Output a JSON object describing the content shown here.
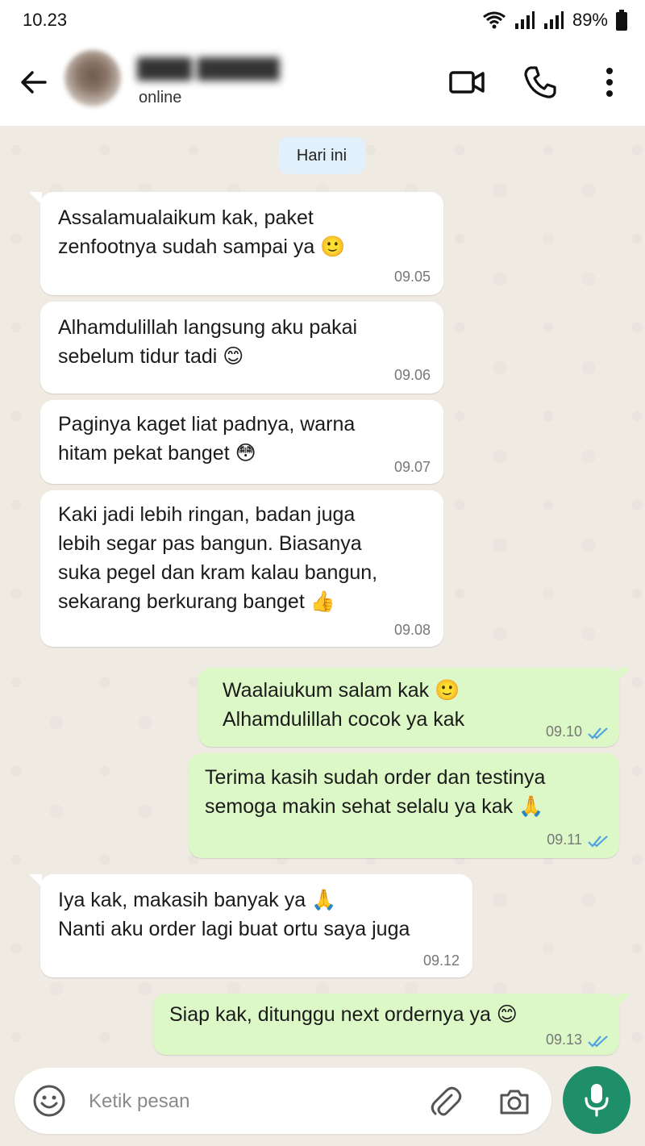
{
  "status_bar": {
    "time": "10.23",
    "battery": "89%"
  },
  "header": {
    "contact_status": "online"
  },
  "chat": {
    "date_chip": "Hari ini",
    "messages": [
      {
        "direction": "in",
        "text": "Assalamualaikum kak, paket\nzenfootnya sudah sampai ya 🙂",
        "time": "09.05"
      },
      {
        "direction": "in",
        "text": "Alhamdulillah langsung aku pakai\nsebelum tidur tadi 😊",
        "time": "09.06"
      },
      {
        "direction": "in",
        "text": "Paginya kaget liat padnya, warna\nhitam pekat banget 😳",
        "time": "09.07"
      },
      {
        "direction": "in",
        "text": "Kaki jadi lebih ringan, badan juga\nlebih segar pas bangun. Biasanya\nsuka pegel dan kram kalau bangun,\nsekarang berkurang banget 👍",
        "time": "09.08"
      },
      {
        "direction": "out",
        "text": "Waalaiukum salam kak 🙂\nAlhamdulillah cocok ya kak",
        "time": "09.10"
      },
      {
        "direction": "out",
        "text": "Terima kasih sudah order dan testinya\nsemoga makin sehat selalu ya kak 🙏",
        "time": "09.11"
      },
      {
        "direction": "in",
        "text": "Iya kak, makasih banyak ya 🙏\nNanti aku order lagi buat ortu saya juga",
        "time": "09.12"
      },
      {
        "direction": "out",
        "text": "Siap kak, ditunggu next ordernya ya 😊",
        "time": "09.13"
      }
    ]
  },
  "composer": {
    "placeholder": "Ketik pesan"
  },
  "colors": {
    "incoming": "#ffffff",
    "outgoing": "#dcf8c6",
    "tick": "#4fa3e0",
    "mic": "#1f8f6a"
  },
  "icons": [
    "back-arrow-icon",
    "video-call-icon",
    "phone-icon",
    "more-vert-icon",
    "emoji-icon",
    "attach-icon",
    "camera-icon",
    "mic-icon",
    "double-tick-icon",
    "wifi-icon",
    "signal-icon",
    "battery-icon"
  ]
}
